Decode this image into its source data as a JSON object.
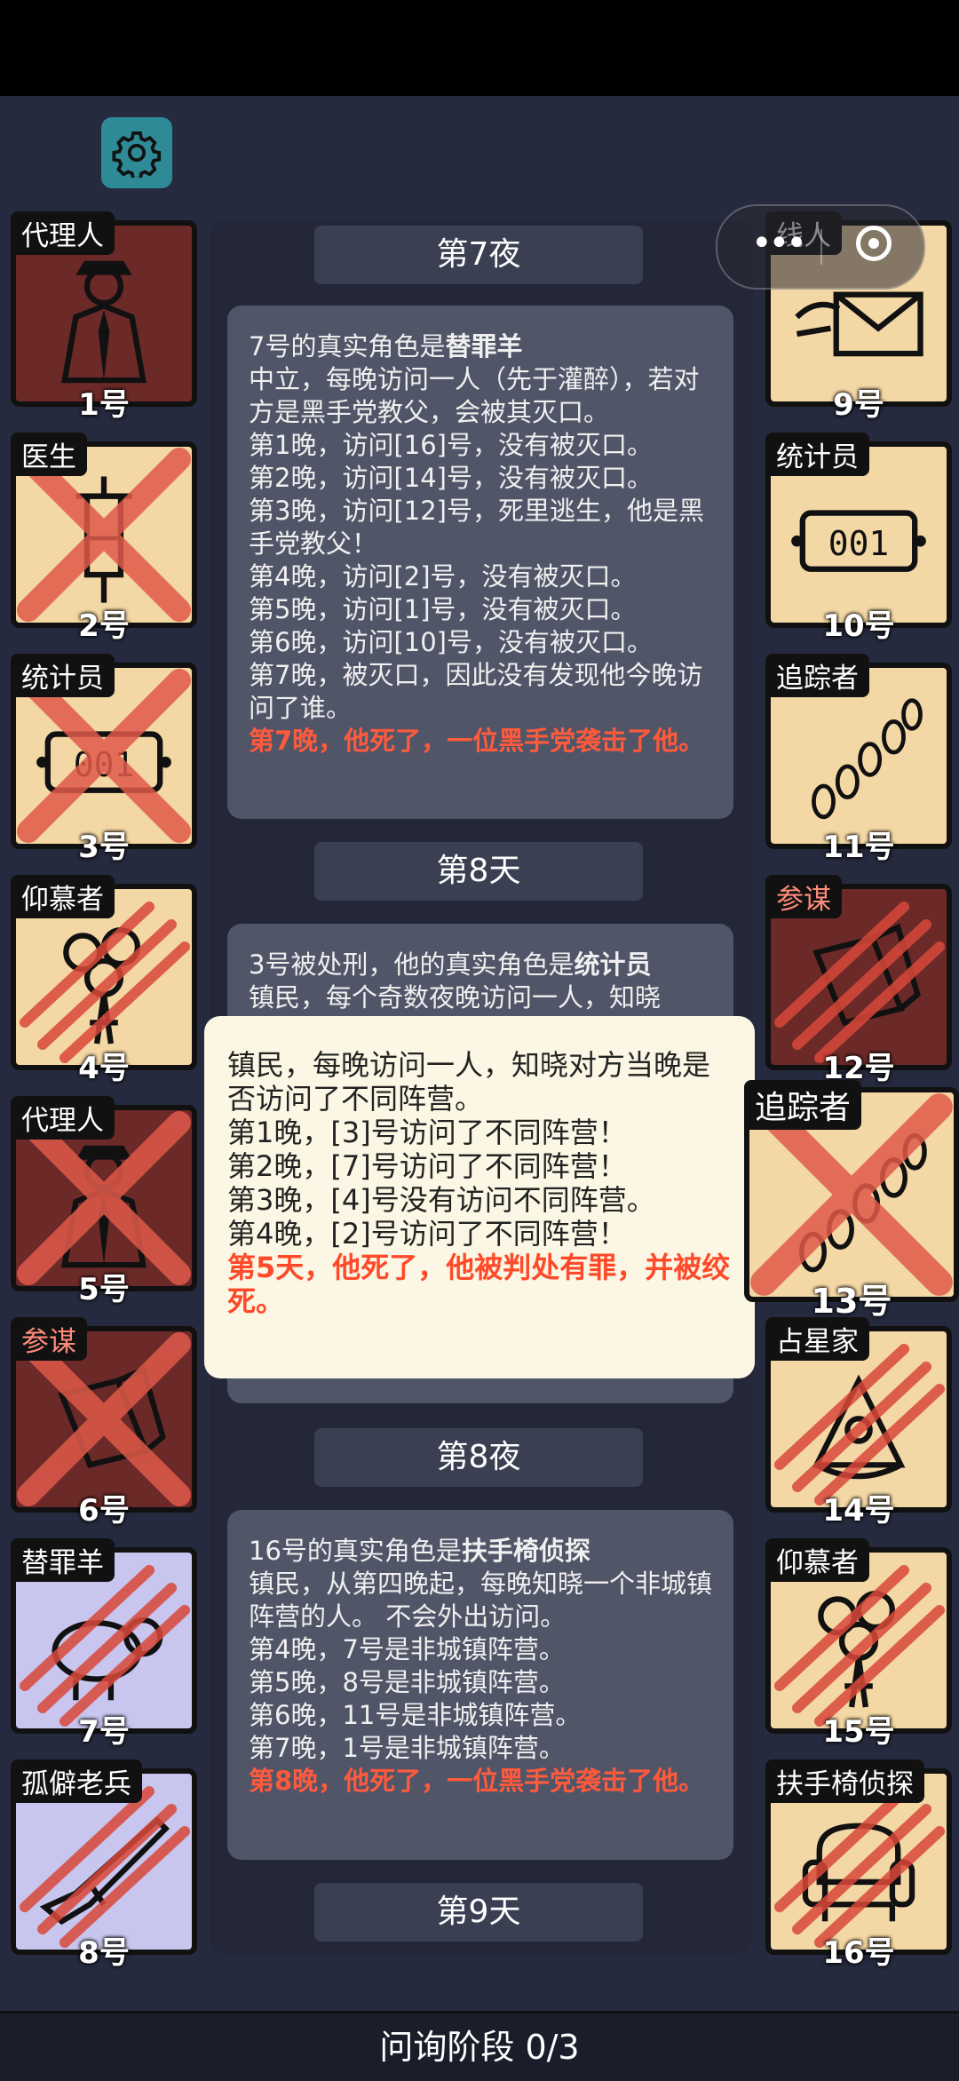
{
  "settings_icon": "gear-icon",
  "capsule": {
    "more_label": "•••",
    "close_icon": "target-icon"
  },
  "left_players": [
    {
      "role": "代理人",
      "number": "1号",
      "bg": "red",
      "icon": "agent-icon",
      "mark": "none",
      "role_color": "#ffffff"
    },
    {
      "role": "医生",
      "number": "2号",
      "bg": "cream",
      "icon": "syringe-icon",
      "mark": "x",
      "role_color": "#ffffff"
    },
    {
      "role": "统计员",
      "number": "3号",
      "bg": "cream",
      "icon": "counter-icon",
      "mark": "x",
      "role_color": "#ffffff"
    },
    {
      "role": "仰慕者",
      "number": "4号",
      "bg": "cream",
      "icon": "flowers-icon",
      "mark": "claw",
      "role_color": "#ffffff"
    },
    {
      "role": "代理人",
      "number": "5号",
      "bg": "red",
      "icon": "agent-icon",
      "mark": "x",
      "role_color": "#ffffff"
    },
    {
      "role": "参谋",
      "number": "6号",
      "bg": "red",
      "icon": "notebook-icon",
      "mark": "x",
      "role_color": "#ff8b7a"
    },
    {
      "role": "替罪羊",
      "number": "7号",
      "bg": "lav",
      "icon": "sheep-icon",
      "mark": "claw",
      "role_color": "#ffffff"
    },
    {
      "role": "孤僻老兵",
      "number": "8号",
      "bg": "lav",
      "icon": "rifle-icon",
      "mark": "claw",
      "role_color": "#ffffff"
    }
  ],
  "right_players": [
    {
      "role": "线人",
      "number": "9号",
      "bg": "cream",
      "icon": "envelope-icon",
      "mark": "none",
      "role_color": "#ffffff"
    },
    {
      "role": "统计员",
      "number": "10号",
      "bg": "cream",
      "icon": "counter-icon",
      "mark": "none",
      "role_color": "#ffffff"
    },
    {
      "role": "追踪者",
      "number": "11号",
      "bg": "cream",
      "icon": "footprints-icon",
      "mark": "none",
      "role_color": "#ffffff"
    },
    {
      "role": "参谋",
      "number": "12号",
      "bg": "red",
      "icon": "notebook-icon",
      "mark": "claw",
      "role_color": "#ff8b7a"
    },
    {
      "role": "占星家",
      "number": "14号",
      "bg": "cream",
      "icon": "sextant-icon",
      "mark": "claw",
      "role_color": "#ffffff"
    },
    {
      "role": "仰慕者",
      "number": "15号",
      "bg": "cream",
      "icon": "flowers-icon",
      "mark": "claw",
      "role_color": "#ffffff"
    },
    {
      "role": "扶手椅侦探",
      "number": "16号",
      "bg": "cream",
      "icon": "armchair-icon",
      "mark": "claw",
      "role_color": "#ffffff"
    }
  ],
  "selected_player": {
    "role": "追踪者",
    "number": "13号",
    "bg": "cream",
    "icon": "footprints-icon",
    "mark": "x"
  },
  "labels": {
    "night7": "第7夜",
    "day8": "第8天",
    "night8": "第8夜",
    "day9": "第9天"
  },
  "msg1": {
    "prefix": "7号的真实角色是",
    "role": "替罪羊",
    "lines": [
      "中立，每晚访问一人（先于灌醉），若对方是黑手党教父，会被其灭口。",
      "第1晚，访问[16]号，没有被灭口。",
      "第2晚，访问[14]号，没有被灭口。",
      "第3晚，访问[12]号，死里逃生，他是黑手党教父！",
      "第4晚，访问[2]号，没有被灭口。",
      "第5晚，访问[1]号，没有被灭口。",
      "第6晚，访问[10]号，没有被灭口。",
      "第7晚，被灭口，因此没有发现他今晚访问了谁。"
    ],
    "death": "第7晚，他死了，一位黑手党袭击了他。"
  },
  "msg2": {
    "prefix": "3号被处刑，他的真实角色是",
    "role": "统计员",
    "line1": "镇民，每个奇数夜晚访问一人，知晓"
  },
  "msg3": {
    "prefix": "16号的真实角色是",
    "role": "扶手椅侦探",
    "lines": [
      "镇民，从第四晚起，每晚知晓一个非城镇阵营的人。 不会外出访问。",
      "第4晚，7号是非城镇阵营。",
      "第5晚，8号是非城镇阵营。",
      "第6晚，11号是非城镇阵营。",
      "第7晚，1号是非城镇阵营。"
    ],
    "death": "第8晚，他死了，一位黑手党袭击了他。"
  },
  "popup": {
    "lines": [
      "镇民，每晚访问一人，知晓对方当晚是否访问了不同阵营。",
      "第1晚，[3]号访问了不同阵营！",
      "第2晚，[7]号访问了不同阵营！",
      "第3晚，[4]号没有访问不同阵营。",
      "第4晚，[2]号访问了不同阵营！"
    ],
    "death": "第5天，他死了，他被判处有罪，并被绞死。"
  },
  "bottom_status": "问询阶段 0/3"
}
